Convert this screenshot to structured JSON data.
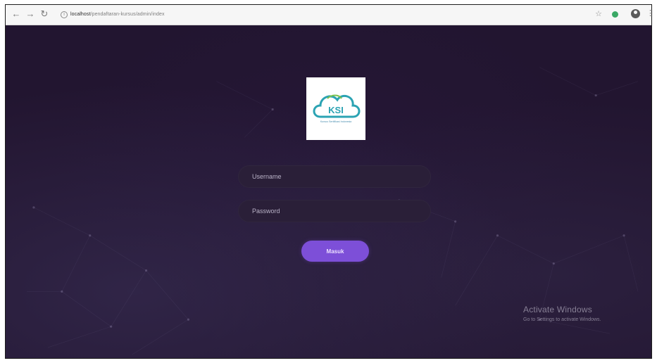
{
  "browser": {
    "url_host": "localhost",
    "url_path": "/pendaftaran-kursus/admin/index",
    "back_icon": "arrow-left-icon",
    "forward_icon": "arrow-right-icon",
    "reload_icon": "reload-icon",
    "bookmark_icon": "star-icon",
    "extension_icon": "extension-dot-icon",
    "profile_icon": "profile-icon",
    "menu_icon": "kebab-menu-icon"
  },
  "logo": {
    "initials": "KSI",
    "tagline": "Kursus Sertifikasi Indonesia"
  },
  "form": {
    "username_placeholder": "Username",
    "password_placeholder": "Password",
    "submit_label": "Masuk"
  },
  "watermark": {
    "title": "Activate Windows",
    "subtitle": "Go to Settings to activate Windows."
  },
  "colors": {
    "background": "#221530",
    "accent": "#7d4fd8",
    "field": "#2a1f38"
  }
}
